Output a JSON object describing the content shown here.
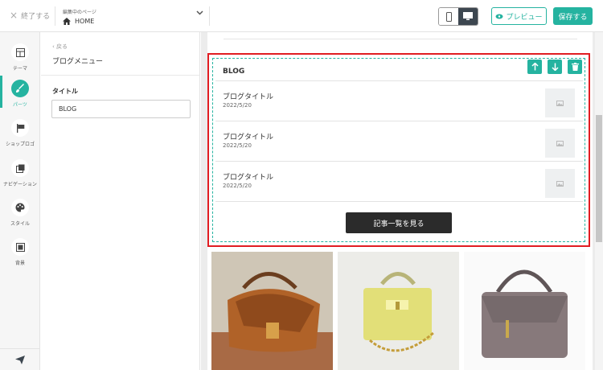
{
  "topbar": {
    "close_label": "終了する",
    "page_caption": "編集中のページ",
    "page_name": "HOME",
    "preview_label": "プレビュー",
    "save_label": "保存する"
  },
  "rail": [
    {
      "label": "テーマ",
      "icon": "layout-icon"
    },
    {
      "label": "パーツ",
      "icon": "brush-icon",
      "active": true
    },
    {
      "label": "ショップロゴ",
      "icon": "flag-icon"
    },
    {
      "label": "ナビゲーション",
      "icon": "navigation-icon"
    },
    {
      "label": "スタイル",
      "icon": "palette-icon"
    },
    {
      "label": "背景",
      "icon": "background-icon"
    }
  ],
  "panel": {
    "back_label": "戻る",
    "title": "ブログメニュー",
    "field_label": "タイトル",
    "field_value": "BLOG"
  },
  "blog": {
    "heading": "BLOG",
    "posts": [
      {
        "title": "ブログタイトル",
        "date": "2022/5/20"
      },
      {
        "title": "ブログタイトル",
        "date": "2022/5/20"
      },
      {
        "title": "ブログタイトル",
        "date": "2022/5/20"
      }
    ],
    "more_label": "記事一覧を見る"
  },
  "colors": {
    "accent": "#25b3a0",
    "highlight": "#e11d22",
    "dark": "#2b2b2b"
  }
}
